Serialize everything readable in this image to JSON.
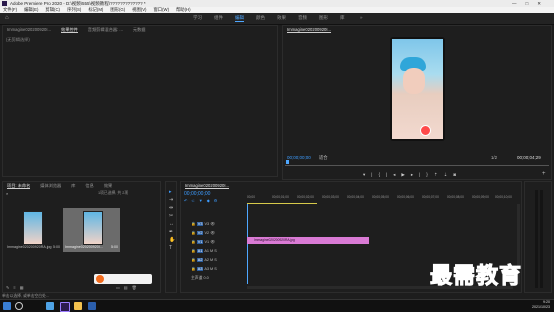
{
  "app": {
    "title": "Adobe Premiere Pro 2020 - D:\\视频\\555\\视频教程\\????????????? *",
    "window_controls": [
      "—",
      "□",
      "✕"
    ]
  },
  "menu": [
    "文件(F)",
    "编辑(E)",
    "剪辑(C)",
    "序列(S)",
    "标记(M)",
    "图形(G)",
    "视图(V)",
    "窗口(W)",
    "帮助(H)"
  ],
  "workspaces": {
    "home_icon": "home-icon",
    "items": [
      "学习",
      "组件",
      "编辑",
      "颜色",
      "效果",
      "音频",
      "图形",
      "库"
    ],
    "active": "编辑",
    "more": "»"
  },
  "source_panel": {
    "tabs": [
      "Immagine020200920I...",
      "效果控件",
      "音频剪辑混合器: ...",
      "元数据"
    ],
    "active": "效果控件",
    "subheader": "(无剪辑选择)"
  },
  "program_monitor": {
    "tab": "Immagine020200920I...",
    "timecode_left": "00;00;00;00",
    "fit": "适合",
    "quality": "1/2",
    "timecode_right": "00;00;04;29"
  },
  "project_panel": {
    "tabs": [
      "项目: 未命名",
      "媒体浏览器",
      "库",
      "信息",
      "效果"
    ],
    "status": "1项已选择, 共 2项",
    "items": [
      {
        "name": "Immagine020200920RA.jpg",
        "duration": "5:00"
      },
      {
        "name": "Immagine020200920I...",
        "duration": "5:00"
      }
    ]
  },
  "timeline": {
    "tab": "Immagine020200920I...",
    "timecode": "00;00;00;00",
    "ruler": [
      "00;00",
      "00;00;01;00",
      "00;00;02;00",
      "00;00;03;00",
      "00;00;04;00",
      "00;00;05;00",
      "00;00;06;00",
      "00;00;07;00",
      "00;00;08;00",
      "00;00;09;00",
      "00;00;10;00"
    ],
    "tracks": [
      {
        "label": "V3",
        "type": "video"
      },
      {
        "label": "V2",
        "type": "video"
      },
      {
        "label": "V1",
        "type": "video"
      },
      {
        "label": "A1",
        "type": "audio"
      },
      {
        "label": "A2",
        "type": "audio"
      },
      {
        "label": "A3",
        "type": "audio"
      }
    ],
    "master": "主声道",
    "master_value": "0.0",
    "clip": {
      "name": "Immagine020200920RA.jpg",
      "color": "#d97ad4"
    }
  },
  "watermark": "最需教育",
  "statusbar": "单击以选择, 或单击空白处...",
  "taskbar": {
    "time": "9:20",
    "date": "2021/10/23"
  }
}
